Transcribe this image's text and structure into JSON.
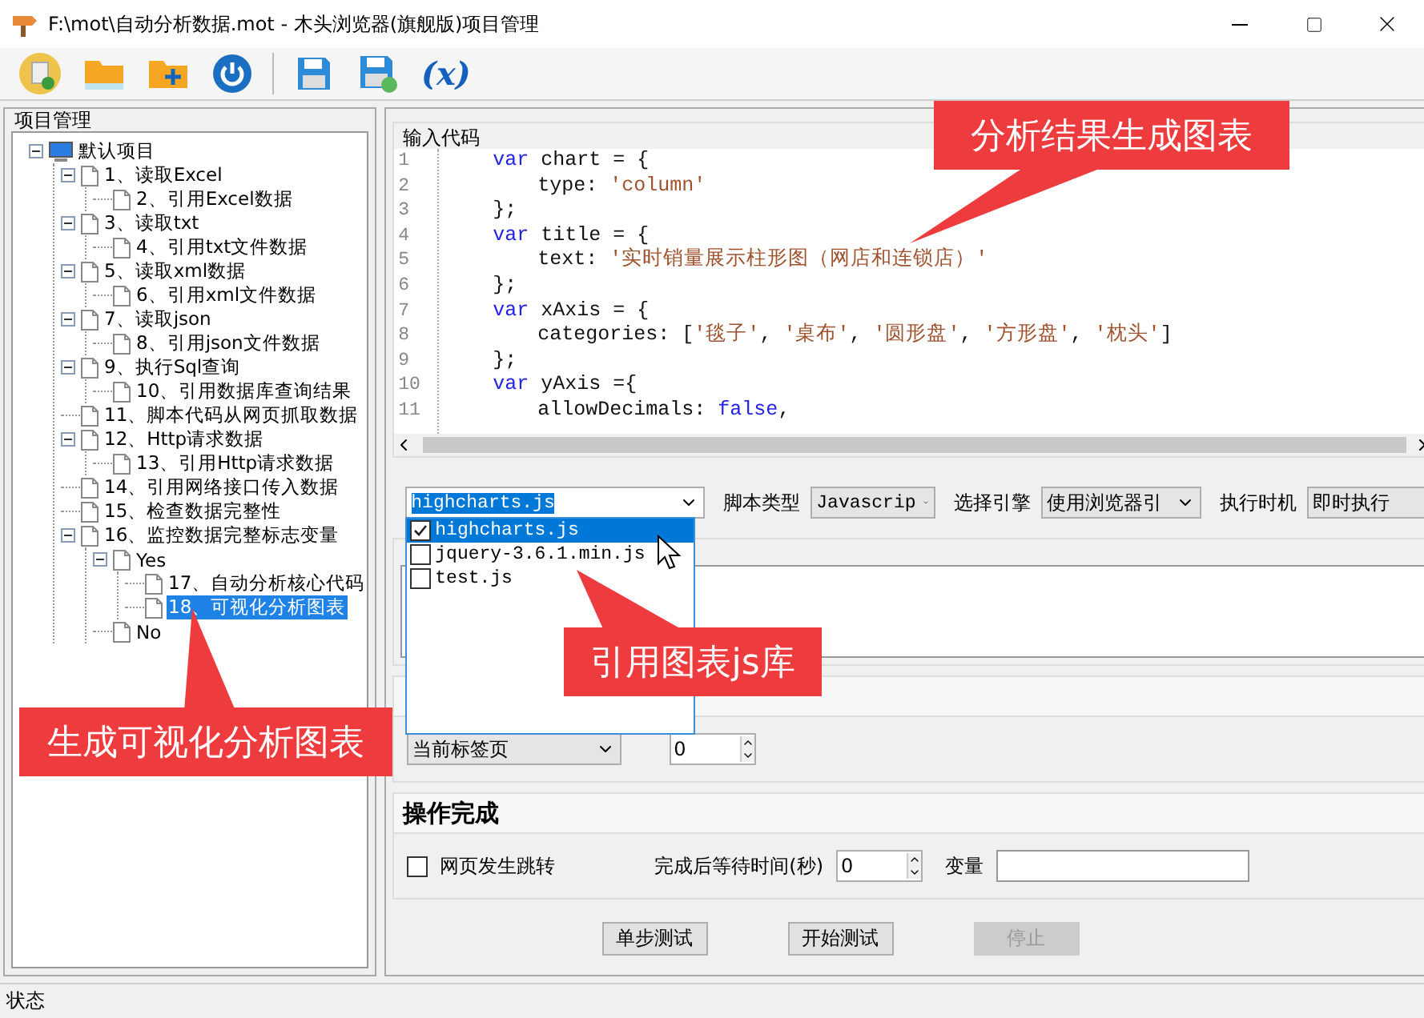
{
  "window": {
    "title": "F:\\mot\\自动分析数据.mot  - 木头浏览器(旗舰版)项目管理"
  },
  "toolbar": [
    {
      "kind": "new"
    },
    {
      "kind": "open"
    },
    {
      "kind": "add"
    },
    {
      "kind": "power"
    },
    {
      "kind": "separator"
    },
    {
      "kind": "save"
    },
    {
      "kind": "saveas"
    },
    {
      "kind": "text",
      "label": "(x)"
    }
  ],
  "project_panel": {
    "title": "项目管理",
    "tree": [
      {
        "label": "默认项目",
        "kind": "computer",
        "expanded": true,
        "selected": false,
        "children": [
          {
            "label": "1、读取Excel",
            "kind": "document",
            "expanded": true,
            "selected": false,
            "children": [
              {
                "label": "2、引用Excel数据",
                "kind": "document",
                "selected": false
              }
            ]
          },
          {
            "label": "3、读取txt",
            "kind": "document",
            "expanded": true,
            "selected": false,
            "children": [
              {
                "label": "4、引用txt文件数据",
                "kind": "document",
                "selected": false
              }
            ]
          },
          {
            "label": "5、读取xml数据",
            "kind": "document",
            "expanded": true,
            "selected": false,
            "children": [
              {
                "label": "6、引用xml文件数据",
                "kind": "document",
                "selected": false
              }
            ]
          },
          {
            "label": "7、读取json",
            "kind": "document",
            "expanded": true,
            "selected": false,
            "children": [
              {
                "label": "8、引用json文件数据",
                "kind": "document",
                "selected": false
              }
            ]
          },
          {
            "label": "9、执行Sql查询",
            "kind": "document",
            "expanded": true,
            "selected": false,
            "children": [
              {
                "label": "10、引用数据库查询结果",
                "kind": "document",
                "selected": false
              }
            ]
          },
          {
            "label": "11、脚本代码从网页抓取数据",
            "kind": "document",
            "selected": false
          },
          {
            "label": "12、Http请求数据",
            "kind": "document",
            "expanded": true,
            "selected": false,
            "children": [
              {
                "label": "13、引用Http请求数据",
                "kind": "document",
                "selected": false
              }
            ]
          },
          {
            "label": "14、引用网络接口传入数据",
            "kind": "document",
            "selected": false
          },
          {
            "label": "15、检查数据完整性",
            "kind": "document",
            "selected": false
          },
          {
            "label": "16、监控数据完整标志变量",
            "kind": "document",
            "expanded": true,
            "selected": false,
            "children": [
              {
                "label": "Yes",
                "kind": "document",
                "expanded": true,
                "selected": false,
                "children": [
                  {
                    "label": "17、自动分析核心代码",
                    "kind": "document",
                    "selected": false
                  },
                  {
                    "label": "18、可视化分析图表",
                    "kind": "document",
                    "selected": true
                  }
                ]
              },
              {
                "label": "No",
                "kind": "document",
                "selected": false
              }
            ]
          }
        ]
      }
    ]
  },
  "code_editor": {
    "title": "输入代码",
    "lines": [
      {
        "number": "1",
        "kind": "statement",
        "tokens": [
          {
            "kind": "keyword",
            "text": "var"
          },
          {
            "kind": "plain",
            "text": " chart = {"
          }
        ]
      },
      {
        "number": "2",
        "kind": "member",
        "tokens": [
          {
            "kind": "plain",
            "text": "type: "
          },
          {
            "kind": "string",
            "text": "'column'"
          }
        ]
      },
      {
        "number": "3",
        "kind": "statement",
        "tokens": [
          {
            "kind": "plain",
            "text": "};"
          }
        ]
      },
      {
        "number": "4",
        "kind": "statement",
        "tokens": [
          {
            "kind": "keyword",
            "text": "var"
          },
          {
            "kind": "plain",
            "text": " title = {"
          }
        ]
      },
      {
        "number": "5",
        "kind": "member",
        "tokens": [
          {
            "kind": "plain",
            "text": "text: "
          },
          {
            "kind": "string",
            "text": "'实时销量展示柱形图（网店和连锁店）'"
          }
        ]
      },
      {
        "number": "6",
        "kind": "statement",
        "tokens": [
          {
            "kind": "plain",
            "text": "};"
          }
        ]
      },
      {
        "number": "7",
        "kind": "statement",
        "tokens": [
          {
            "kind": "keyword",
            "text": "var"
          },
          {
            "kind": "plain",
            "text": " xAxis = {"
          }
        ]
      },
      {
        "number": "8",
        "kind": "member",
        "tokens": [
          {
            "kind": "plain",
            "text": "categories: ["
          },
          {
            "kind": "string",
            "text": "'毯子'"
          },
          {
            "kind": "plain",
            "text": ", "
          },
          {
            "kind": "string",
            "text": "'桌布'"
          },
          {
            "kind": "plain",
            "text": ", "
          },
          {
            "kind": "string",
            "text": "'圆形盘'"
          },
          {
            "kind": "plain",
            "text": ", "
          },
          {
            "kind": "string",
            "text": "'方形盘'"
          },
          {
            "kind": "plain",
            "text": ", "
          },
          {
            "kind": "string",
            "text": "'枕头'"
          },
          {
            "kind": "plain",
            "text": "]"
          }
        ]
      },
      {
        "number": "9",
        "kind": "statement",
        "tokens": [
          {
            "kind": "plain",
            "text": "};"
          }
        ]
      },
      {
        "number": "10",
        "kind": "statement",
        "tokens": [
          {
            "kind": "keyword",
            "text": "var"
          },
          {
            "kind": "plain",
            "text": " yAxis ={"
          }
        ]
      },
      {
        "number": "11",
        "kind": "member",
        "tokens": [
          {
            "kind": "plain",
            "text": "allowDecimals: "
          },
          {
            "kind": "keyword",
            "text": "false"
          },
          {
            "kind": "plain",
            "text": ","
          }
        ]
      }
    ]
  },
  "script_row": {
    "library": {
      "value": "highcharts.js",
      "open": true,
      "options": [
        {
          "label": "highcharts.js",
          "checked": true,
          "selected": true
        },
        {
          "label": "jquery-3.6.1.min.js",
          "checked": false,
          "selected": false
        },
        {
          "label": "test.js",
          "checked": false,
          "selected": false
        }
      ]
    },
    "fields": [
      {
        "label": "脚本类型",
        "value": "Javascrip"
      },
      {
        "label": "选择引擎",
        "value": "使用浏览器引"
      },
      {
        "label": "执行时机",
        "value": "即时执行"
      }
    ]
  },
  "tab_section": {
    "expanded": true,
    "target": "当前标签页",
    "count": "0"
  },
  "complete_section": {
    "title": "操作完成",
    "expanded": true,
    "redirect": {
      "label": "网页发生跳转",
      "checked": false
    },
    "wait": {
      "label": "完成后等待时间(秒)",
      "value": "0"
    },
    "variable": {
      "label": "变量"
    }
  },
  "buttons": [
    {
      "label": "单步测试",
      "disabled": false
    },
    {
      "label": "开始测试",
      "disabled": false
    },
    {
      "label": "停止",
      "disabled": true
    }
  ],
  "callouts": [
    {
      "text": "分析结果生成图表"
    },
    {
      "text": "引用图表js库"
    },
    {
      "text": "生成可视化分析图表"
    }
  ],
  "status_bar": {
    "text": "状态"
  }
}
